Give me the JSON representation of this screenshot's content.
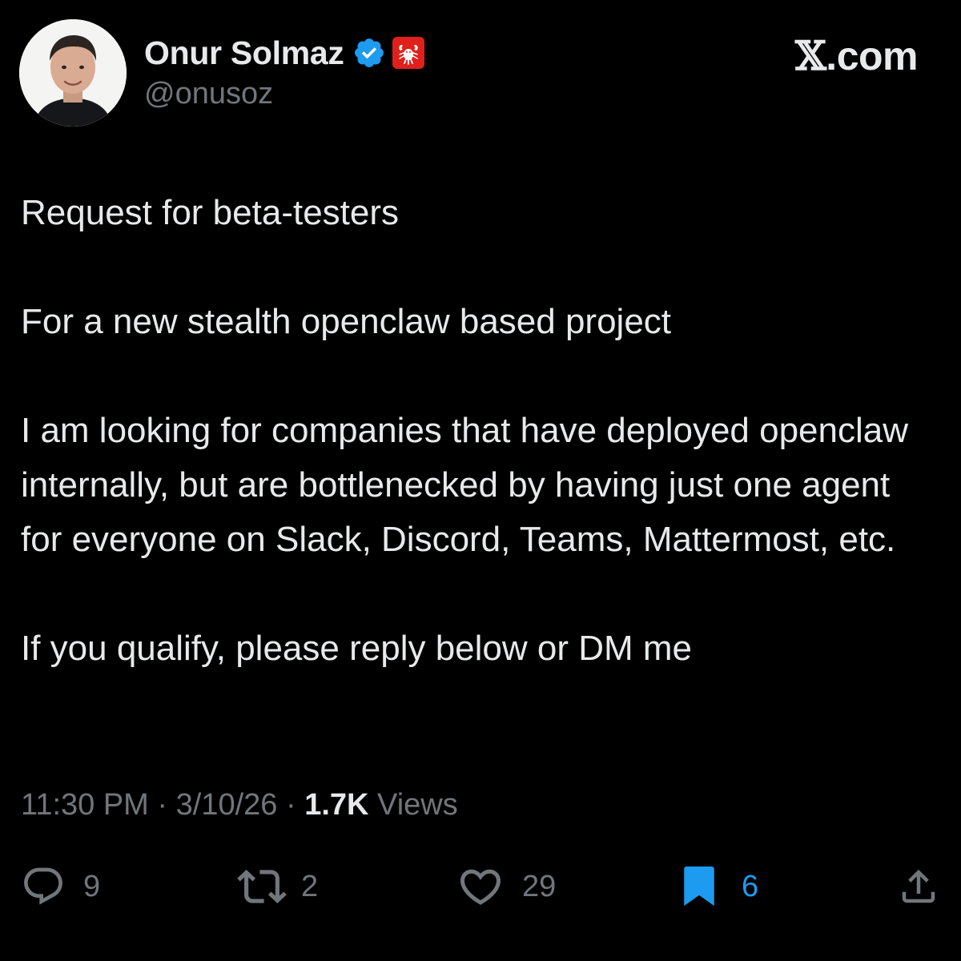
{
  "author": {
    "display_name": "Onur Solmaz",
    "handle": "@onusoz",
    "verified_icon": "verified-badge-icon",
    "affiliate_icon": "lobster-badge-icon",
    "verified_color": "#1d9bf0",
    "affiliate_color": "#e0211b"
  },
  "brand": {
    "x_glyph": "𝕏",
    "suffix": ".com"
  },
  "tweet": {
    "paragraphs": [
      "Request for beta-testers",
      "For a new stealth openclaw based project",
      "I am looking for companies that have deployed openclaw internally, but are bottlenecked by having just one agent for everyone on Slack, Discord, Teams, Mattermost, etc.",
      "If you qualify, please reply below or DM me"
    ]
  },
  "meta": {
    "time": "11:30 PM",
    "separator": " · ",
    "date": "3/10/26",
    "views_count": "1.7K",
    "views_label": " Views"
  },
  "actions": {
    "reply": {
      "icon": "reply-icon",
      "count": "9"
    },
    "repost": {
      "icon": "repost-icon",
      "count": "2"
    },
    "like": {
      "icon": "heart-icon",
      "count": "29"
    },
    "bookmark": {
      "icon": "bookmark-filled-icon",
      "count": "6",
      "active": true,
      "color": "#1d9bf0"
    },
    "share": {
      "icon": "share-icon"
    }
  },
  "colors": {
    "background": "#000000",
    "text": "#e7e9ea",
    "secondary": "#71767b",
    "accent": "#1d9bf0"
  }
}
